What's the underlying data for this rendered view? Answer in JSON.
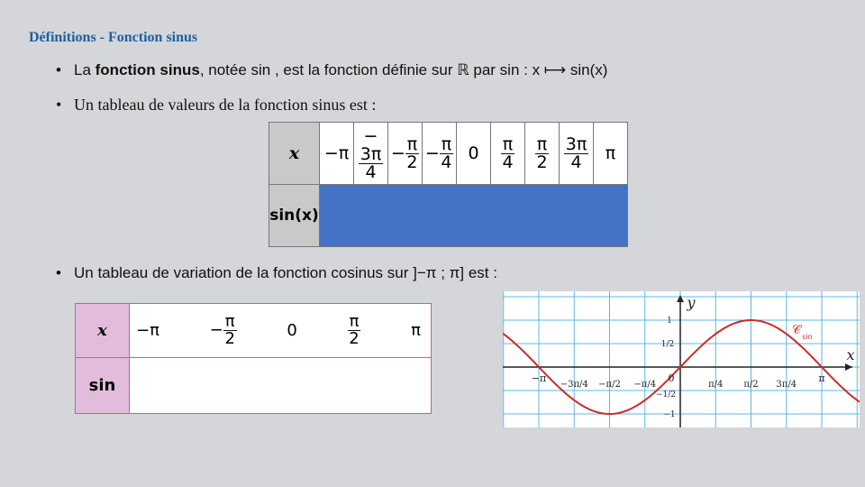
{
  "title": "Définitions - Fonction sinus",
  "bullets": {
    "b1_pre": "La ",
    "b1_bold": "fonction sinus",
    "b1_rest": ", notée sin    , est la fonction définie sur ℝ par sin : x ⟼ sin(x)",
    "b2": "Un tableau de valeurs de la fonction sinus est :",
    "b3": "Un tableau de variation de la fonction cosinus sur ]−π ; π] est :"
  },
  "values_table": {
    "header": "x",
    "row2": "sin(x)",
    "columns": [
      {
        "t": "−π"
      },
      {
        "s": "−",
        "n": "3π",
        "d": "4"
      },
      {
        "s": "−",
        "n": "π",
        "d": "2"
      },
      {
        "s": "−",
        "n": "π",
        "d": "4"
      },
      {
        "t": "0"
      },
      {
        "n": "π",
        "d": "4"
      },
      {
        "n": "π",
        "d": "2"
      },
      {
        "n": "3π",
        "d": "4"
      },
      {
        "t": "π"
      }
    ],
    "fill_color": "#4472c4"
  },
  "variation_table": {
    "header": "x",
    "row2": "sin",
    "minus_pi": "−π",
    "minus": "−",
    "pi": "π",
    "two": "2",
    "zero": "0",
    "pi_end": "π",
    "border_color": "#c060a0"
  },
  "graph": {
    "x_axis": "x",
    "y_axis": "y",
    "curve_label": "𝒞",
    "curve_sub": "sin",
    "curve_color": "#cc2a2a",
    "grid_color": "#5bb8e6",
    "x_ticks": [
      "−π",
      "−3π/4",
      "−π/2",
      "−π/4",
      "0",
      "π/4",
      "π/2",
      "3π/4",
      "π"
    ],
    "y_ticks": [
      "1",
      "1/2",
      "−1/2",
      "−1"
    ]
  }
}
